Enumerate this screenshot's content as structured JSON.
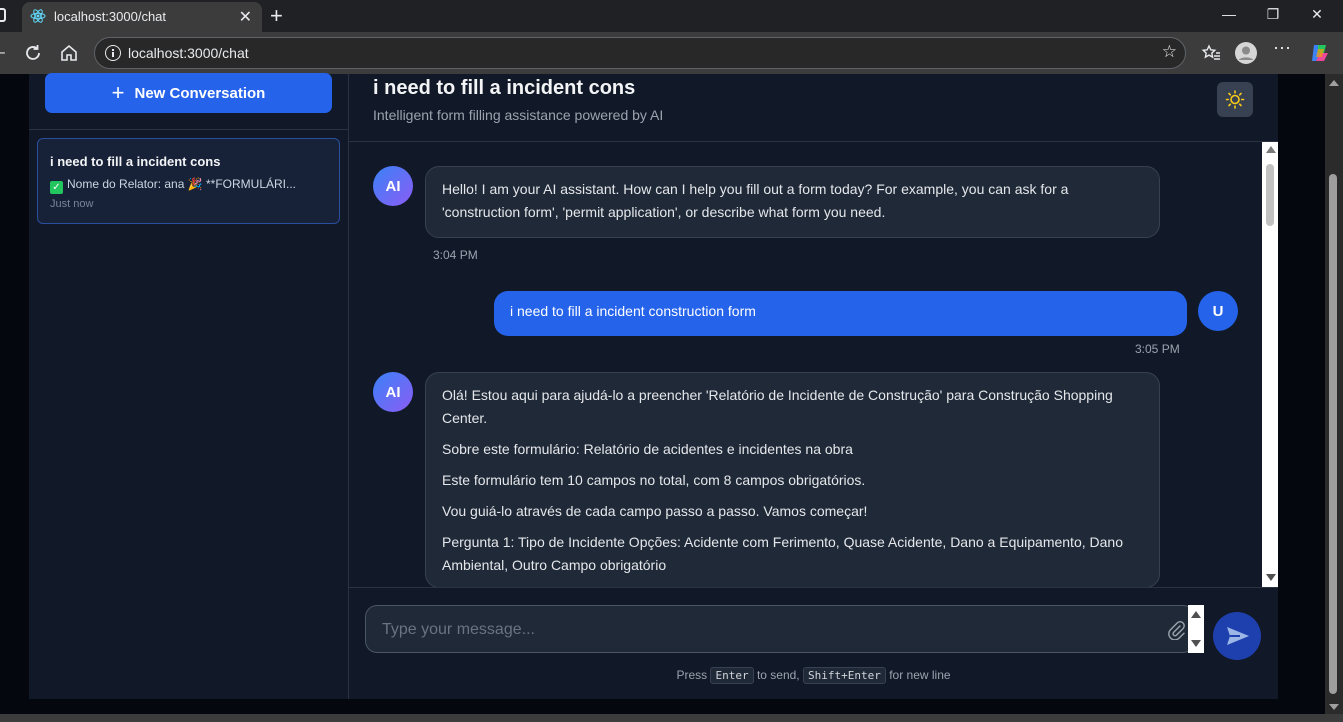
{
  "browser": {
    "tab_title": "localhost:3000/chat",
    "url": "localhost:3000/chat"
  },
  "sidebar": {
    "new_conversation_label": "New Conversation",
    "conversations": [
      {
        "title": "i need to fill a incident cons",
        "preview": "Nome do Relator: ana 🎉 **FORMULÁRI...",
        "time": "Just now"
      }
    ]
  },
  "header": {
    "title": "i need to fill a incident cons",
    "subtitle": "Intelligent form filling assistance powered by AI"
  },
  "messages": [
    {
      "role": "ai",
      "avatar": "AI",
      "paragraphs": [
        "Hello! I am your AI assistant. How can I help you fill out a form today? For example, you can ask for a 'construction form', 'permit application', or describe what form you need."
      ],
      "time": "3:04 PM"
    },
    {
      "role": "user",
      "avatar": "U",
      "text": "i need to fill a incident construction form",
      "time": "3:05 PM"
    },
    {
      "role": "ai",
      "avatar": "AI",
      "paragraphs": [
        "Olá! Estou aqui para ajudá-lo a preencher 'Relatório de Incidente de Construção' para Construção Shopping Center.",
        "Sobre este formulário: Relatório de acidentes e incidentes na obra",
        "Este formulário tem 10 campos no total, com 8 campos obrigatórios.",
        "Vou guiá-lo através de cada campo passo a passo. Vamos começar!",
        "Pergunta 1: Tipo de Incidente Opções: Acidente com Ferimento, Quase Acidente, Dano a Equipamento, Dano Ambiental, Outro Campo obrigatório"
      ]
    }
  ],
  "composer": {
    "placeholder": "Type your message...",
    "hint_press": "Press",
    "hint_enter": "Enter",
    "hint_to_send": "to send,",
    "hint_shift_enter": "Shift+Enter",
    "hint_new_line": "for new line"
  },
  "colors": {
    "accent": "#2563eb",
    "background": "#111827",
    "bubble": "#1f2937"
  }
}
